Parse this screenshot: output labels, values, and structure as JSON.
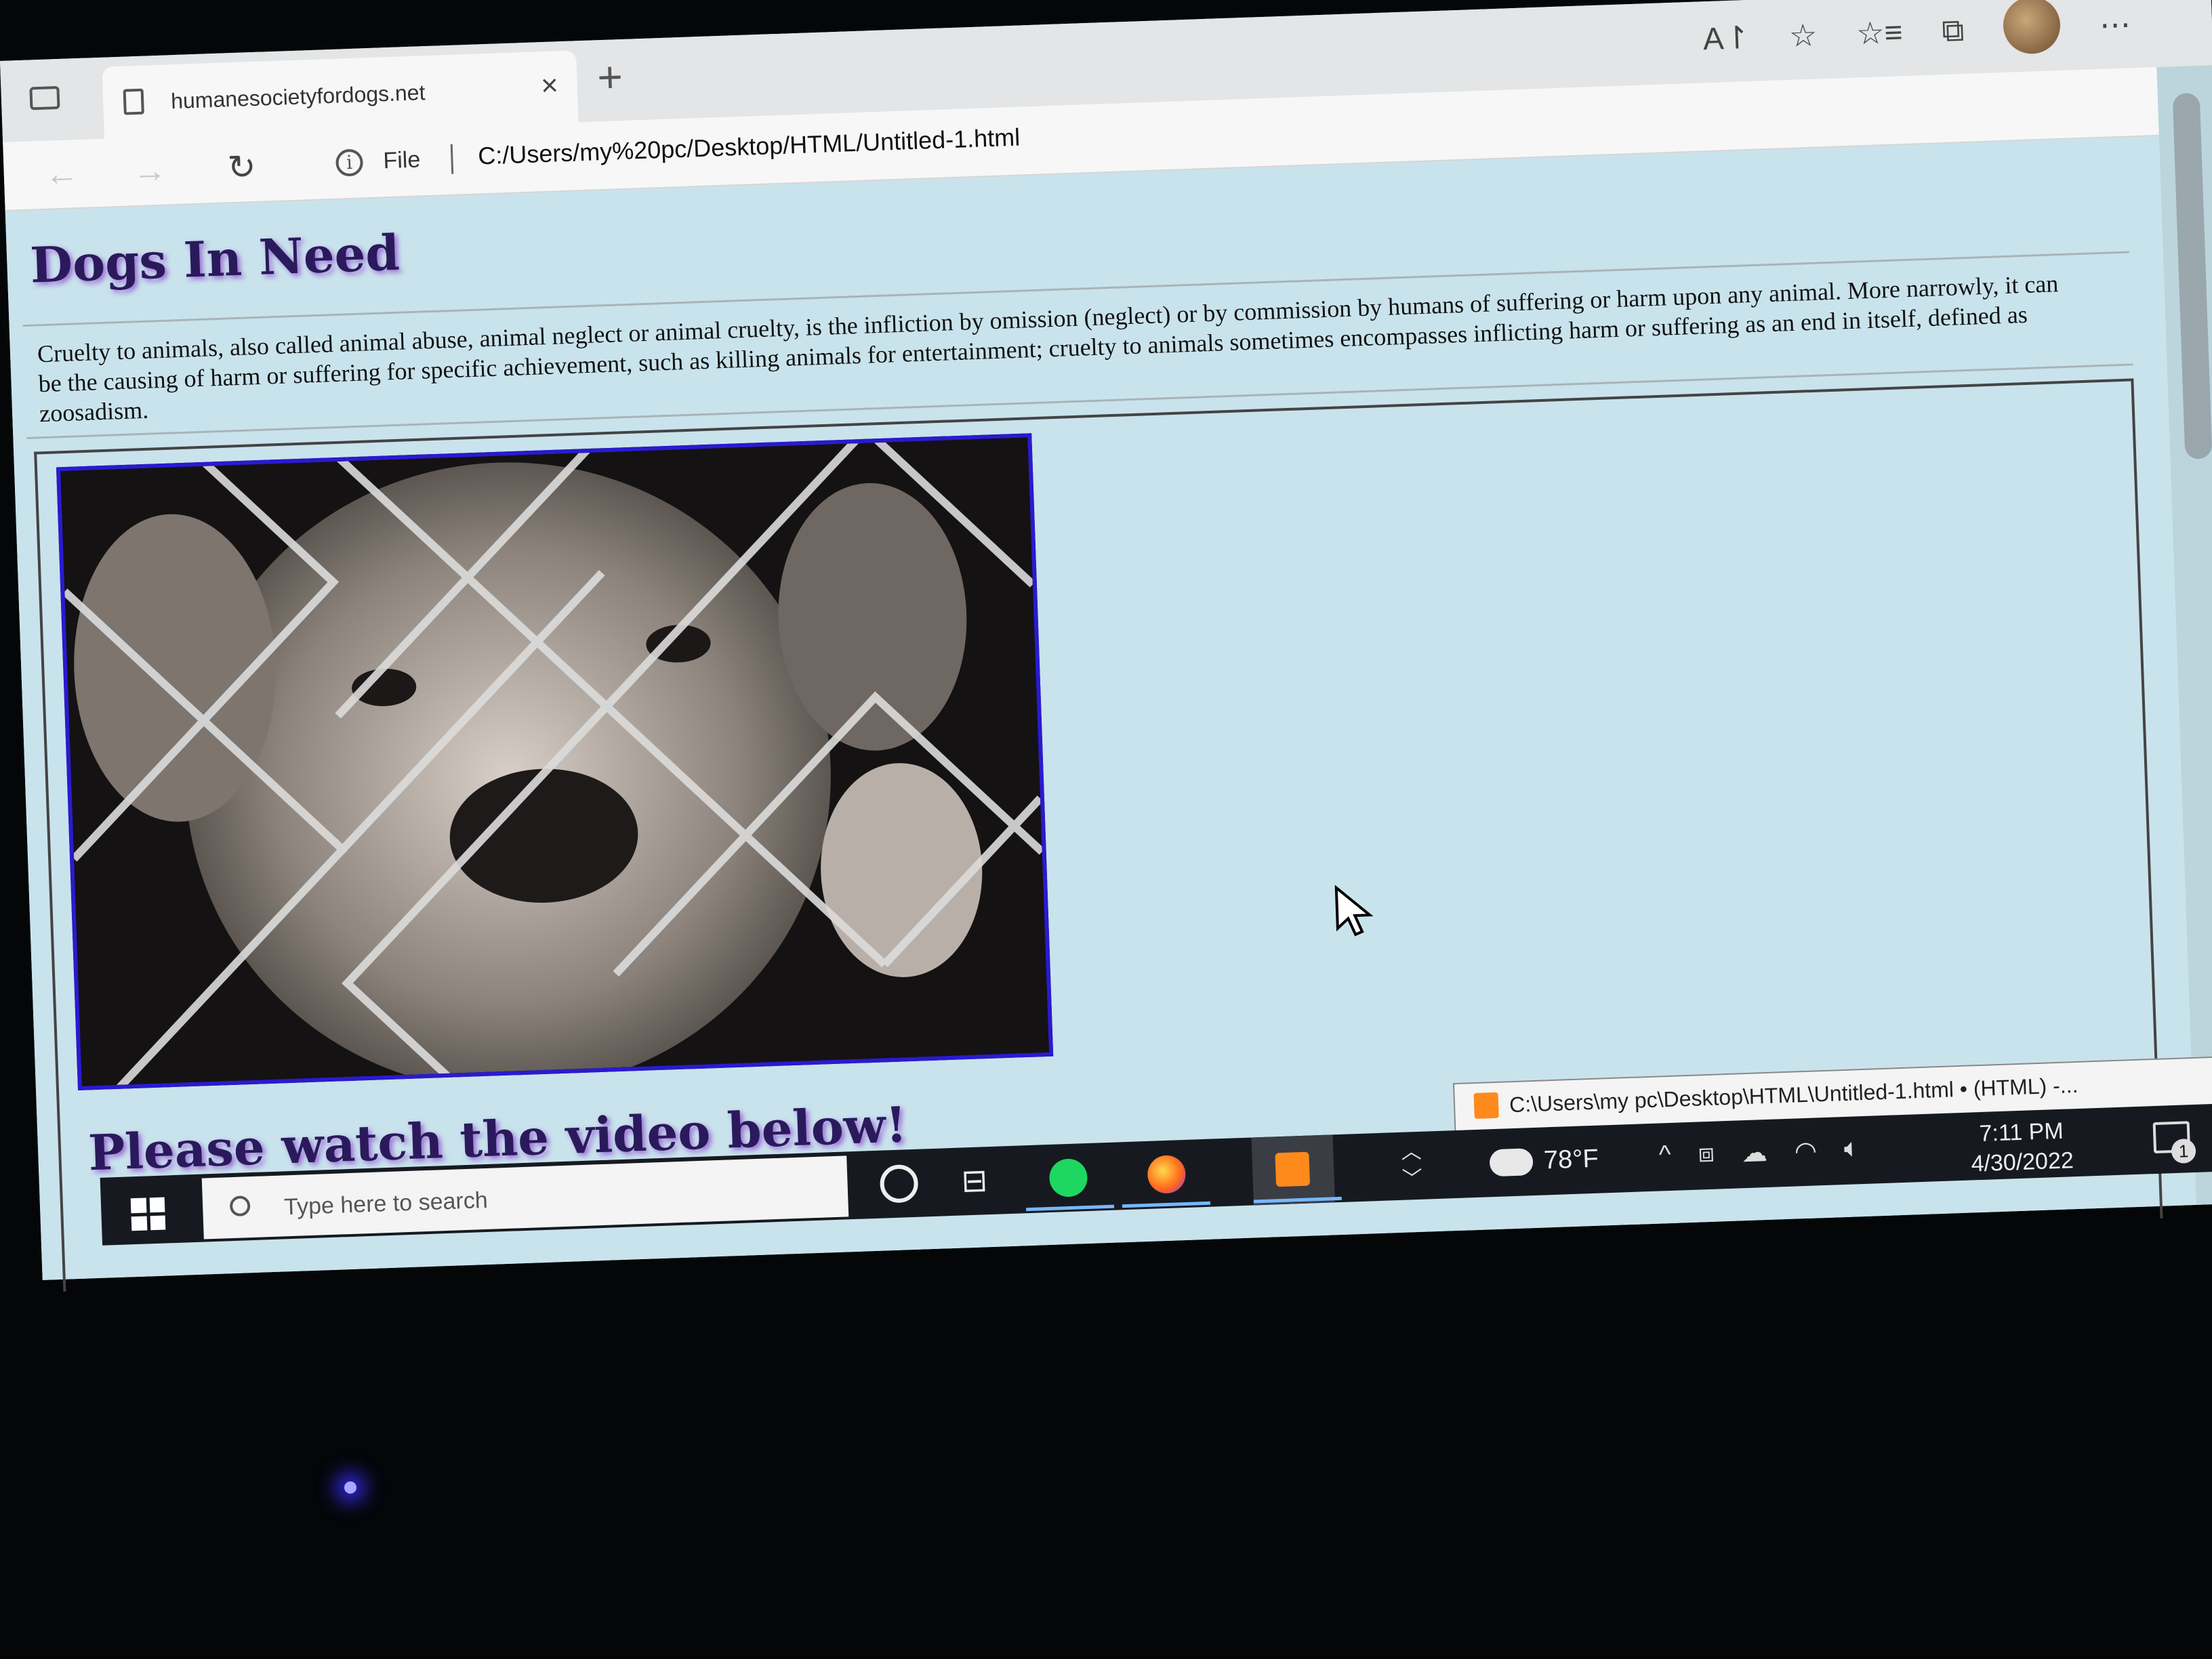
{
  "browser": {
    "tab_title": "humanesocietyfordogs.net",
    "tab_close": "×",
    "new_tab": "+",
    "address_scheme_label": "File",
    "url": "C:/Users/my%20pc/Desktop/HTML/Untitled-1.html",
    "toolbar_icons": [
      "read-aloud-icon",
      "add-favorite-icon",
      "favorites-icon",
      "collections-icon",
      "profile-avatar",
      "more-icon"
    ]
  },
  "page": {
    "heading": "Dogs In Need",
    "paragraph": "Cruelty to animals, also called animal abuse, animal neglect or animal cruelty, is the infliction by omission (neglect) or by commission by humans of suffering or harm upon any animal. More narrowly, it can be the causing of harm or suffering for specific achievement, such as killing animals for entertainment; cruelty to animals sometimes encompasses inflicting harm or suffering as an end in itself, defined as zoosadism.",
    "subheading": "Please watch the video below!"
  },
  "taskbar": {
    "search_placeholder": "Type here to search",
    "sublime_tooltip": "C:\\Users\\my pc\\Desktop\\HTML\\Untitled-1.html • (HTML) -...",
    "temperature": "78°F",
    "time": "7:11 PM",
    "date": "4/30/2022",
    "notification_count": "1"
  },
  "colors": {
    "page_background": "#c9e3ec",
    "heading_color": "#2a1a5c",
    "heading_glow": "#9b6bd6",
    "image_border": "#2a1ad0",
    "taskbar": "#161a20"
  }
}
